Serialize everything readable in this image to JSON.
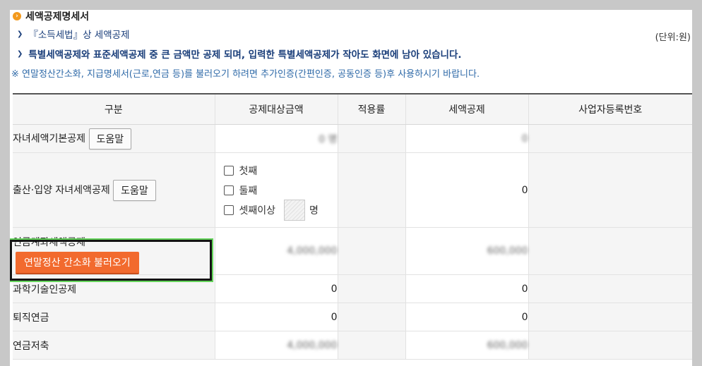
{
  "header": {
    "title": "세액공제명세서",
    "link1": "『소득세법』상 세액공제",
    "notice": "특별세액공제와 표준세액공제 중 큰 금액만 공제 되며, 입력한 특별세액공제가 작아도 화면에 남아 있습니다.",
    "unit": "(단위:원)",
    "note": "※ 연말정산간소화, 지급명세서(근로,연금 등)를 불러오기 하려면 추가인증(간편인증, 공동인증 등)후 사용하시기 바랍니다."
  },
  "table": {
    "columns": [
      "구분",
      "공제대상금액",
      "적용률",
      "세액공제",
      "사업자등록번호"
    ],
    "rows": [
      {
        "label": "자녀세액기본공제",
        "help": "도움말",
        "amount": "0 명",
        "credit": "0"
      },
      {
        "label": "출산·입양 자녀세액공제",
        "help": "도움말",
        "options": [
          "첫째",
          "둘째",
          "셋째이상"
        ],
        "unit_person": "명",
        "credit": "0"
      },
      {
        "label": "연금계좌세액공제",
        "button": "연말정산 간소화 불러오기",
        "amount": "4,000,000",
        "credit": "600,000"
      },
      {
        "label": "과학기술인공제",
        "amount": "0",
        "credit": "0"
      },
      {
        "label": "퇴직연금",
        "amount": "0",
        "credit": "0"
      },
      {
        "label": "연금저축",
        "amount": "4,000,000",
        "credit": "600,000"
      }
    ]
  },
  "colors": {
    "accent": "#f26a2e",
    "highlight": "#63d35a",
    "link": "#1a3e7a"
  }
}
